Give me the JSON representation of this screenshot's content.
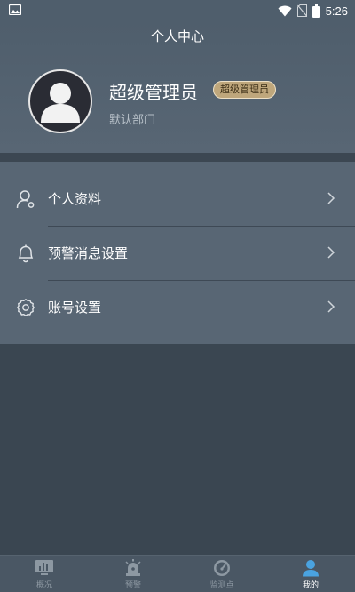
{
  "status_bar": {
    "time": "5:26"
  },
  "header": {
    "title": "个人中心"
  },
  "profile": {
    "name": "超级管理员",
    "role_badge": "超级管理员",
    "department": "默认部门"
  },
  "menu": {
    "items": [
      {
        "label": "个人资料",
        "icon": "user-gear-icon"
      },
      {
        "label": "预警消息设置",
        "icon": "bell-icon"
      },
      {
        "label": "账号设置",
        "icon": "gear-icon"
      }
    ]
  },
  "tabs": [
    {
      "label": "概况",
      "icon": "chart-icon"
    },
    {
      "label": "预警",
      "icon": "alarm-icon"
    },
    {
      "label": "监测点",
      "icon": "gauge-icon"
    },
    {
      "label": "我的",
      "icon": "person-icon"
    }
  ],
  "colors": {
    "header": "#586674",
    "body": "#3a4651",
    "badge": "#bfa77c",
    "active_tab": "#4aa3e0"
  }
}
